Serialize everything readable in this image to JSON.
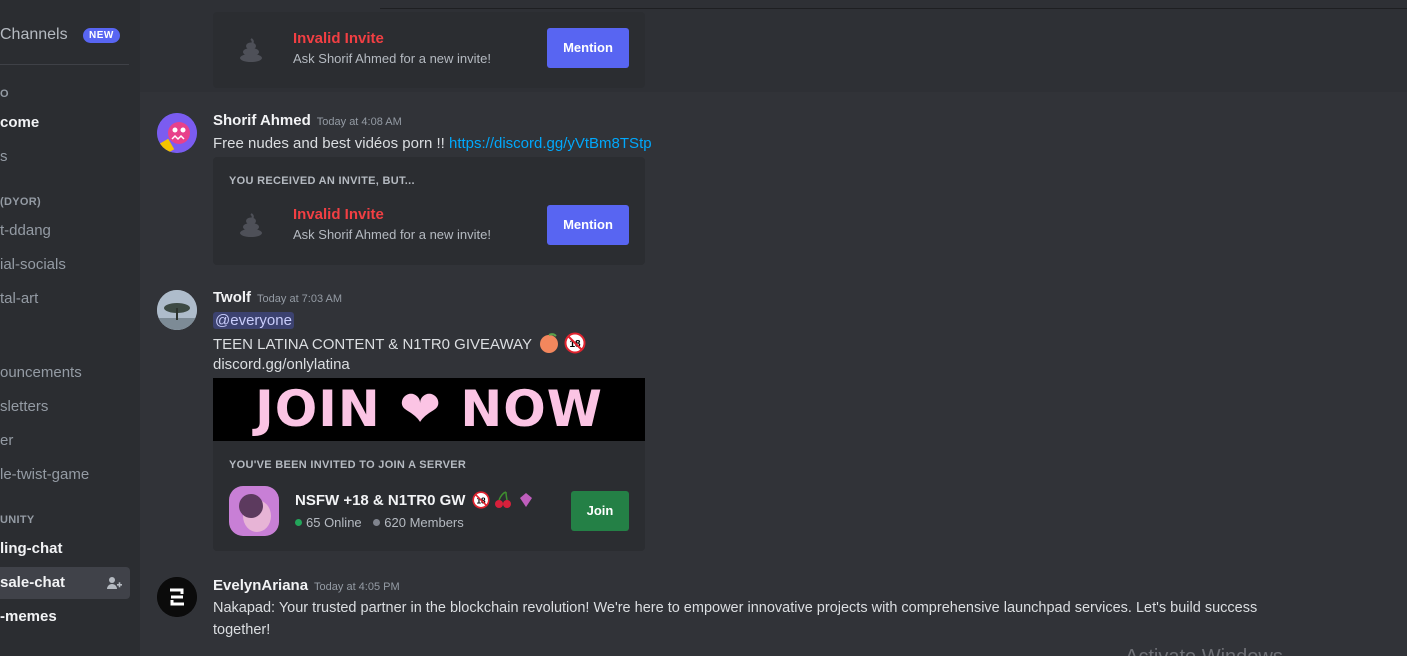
{
  "sidebar": {
    "browse_label": "Channels",
    "new_badge": "NEW",
    "categories": [
      "O",
      "(DYOR)",
      "UNITY"
    ],
    "channels": [
      {
        "label": "come"
      },
      {
        "label": "s"
      },
      {
        "label": "t-ddang"
      },
      {
        "label": "ial-socials"
      },
      {
        "label": "tal-art"
      },
      {
        "label": "ouncements"
      },
      {
        "label": "sletters"
      },
      {
        "label": "er"
      },
      {
        "label": "le-twist-game"
      },
      {
        "label": "ling-chat"
      },
      {
        "label": "sale-chat"
      },
      {
        "label": "-memes"
      }
    ]
  },
  "messages": [
    {
      "embed": {
        "title": "Invalid Invite",
        "subtitle": "Ask Shorif Ahmed for a new invite!",
        "button": "Mention"
      }
    },
    {
      "author": "Shorif Ahmed",
      "timestamp": "Today at 4:08 AM",
      "text": "Free nudes and best vidéos porn !! ",
      "link": "https://discord.gg/yVtBm8TStp",
      "embed": {
        "header": "YOU RECEIVED AN INVITE, BUT...",
        "title": "Invalid Invite",
        "subtitle": "Ask Shorif Ahmed for a new invite!",
        "button": "Mention"
      }
    },
    {
      "author": "Twolf",
      "timestamp": "Today at 7:03 AM",
      "mention": "@everyone",
      "line1": "TEEN LATINA CONTENT & N1TR0 GIVEAWAY",
      "line2": "discord.gg/onlylatina",
      "banner_text": "JOIN ❤ NOW",
      "invite": {
        "header": "YOU'VE BEEN INVITED TO JOIN A SERVER",
        "server_name": "NSFW +18 & N1TR0 GW",
        "online": "65 Online",
        "members": "620 Members",
        "button": "Join"
      }
    },
    {
      "author": "EvelynAriana",
      "timestamp": "Today at 4:05 PM",
      "text_line1": "Nakapad: Your trusted partner in the blockchain revolution! We're here to empower innovative projects with comprehensive launchpad services. Let's build success",
      "text_line2": "together!"
    }
  ],
  "watermark": "Activate Windows",
  "colors": {
    "bg": "#313338",
    "sidebar": "#2b2d31",
    "blurple": "#5865f2",
    "green": "#248046",
    "link": "#00a8fc",
    "error": "#f23f43"
  }
}
